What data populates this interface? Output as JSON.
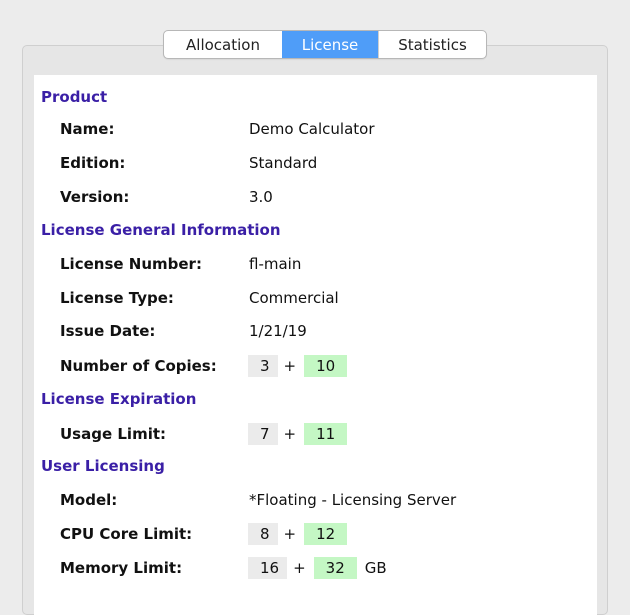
{
  "tabs": {
    "allocation": "Allocation",
    "license": "License",
    "statistics": "Statistics"
  },
  "product": {
    "heading": "Product",
    "name_label": "Name:",
    "name_value": "Demo Calculator",
    "edition_label": "Edition:",
    "edition_value": "Standard",
    "version_label": "Version:",
    "version_value": "3.0"
  },
  "general": {
    "heading": "License General Information",
    "number_label": "License Number:",
    "number_value": "fl-main",
    "type_label": "License Type:",
    "type_value": "Commercial",
    "issue_label": "Issue Date:",
    "issue_value": "1/21/19",
    "copies_label": "Number of Copies:",
    "copies_base": "3",
    "copies_plus": "+",
    "copies_extra": "10"
  },
  "expiration": {
    "heading": "License Expiration",
    "usage_label": "Usage Limit:",
    "usage_base": "7",
    "usage_plus": "+",
    "usage_extra": "11"
  },
  "user_licensing": {
    "heading": "User Licensing",
    "model_label": "Model:",
    "model_value": "*Floating - Licensing Server",
    "cpu_label": "CPU Core Limit:",
    "cpu_base": "8",
    "cpu_plus": "+",
    "cpu_extra": "12",
    "memory_label": "Memory Limit:",
    "memory_base": "16",
    "memory_plus": "+",
    "memory_extra": "32",
    "memory_unit": "GB"
  },
  "colors": {
    "section_heading": "#3a1fa6",
    "active_tab": "#4f9df8",
    "extra_highlight": "#c4f7c4",
    "base_box": "#ebebeb"
  }
}
